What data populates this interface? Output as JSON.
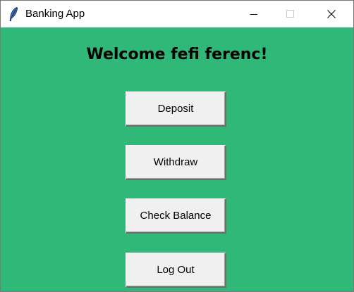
{
  "window": {
    "title": "Banking App",
    "icons": {
      "app": "feather-icon",
      "minimize": "minimize-icon",
      "maximize": "maximize-icon",
      "close": "close-icon"
    }
  },
  "main": {
    "welcome_text": "Welcome fefi ferenc!",
    "buttons": {
      "deposit": "Deposit",
      "withdraw": "Withdraw",
      "check_balance": "Check Balance",
      "log_out": "Log Out"
    }
  },
  "colors": {
    "background": "#2fb877",
    "button_face": "#f0f0f0",
    "titlebar": "#ffffff"
  }
}
